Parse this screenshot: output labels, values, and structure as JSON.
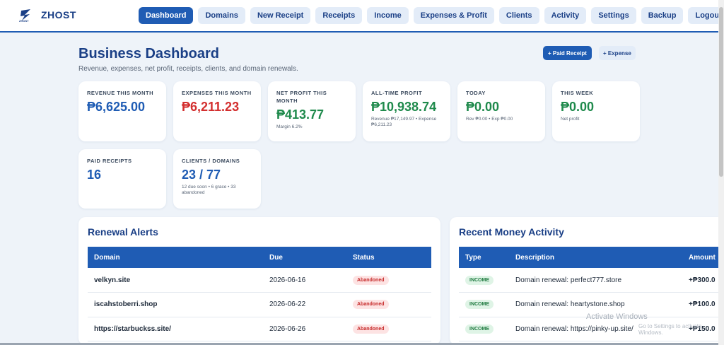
{
  "brand": {
    "name": "ZHOST"
  },
  "nav": [
    {
      "label": "Dashboard",
      "active": true
    },
    {
      "label": "Domains"
    },
    {
      "label": "New Receipt"
    },
    {
      "label": "Receipts"
    },
    {
      "label": "Income"
    },
    {
      "label": "Expenses & Profit"
    },
    {
      "label": "Clients"
    },
    {
      "label": "Activity"
    },
    {
      "label": "Settings"
    },
    {
      "label": "Backup"
    },
    {
      "label": "Logout"
    }
  ],
  "header": {
    "title": "Business Dashboard",
    "subtitle": "Revenue, expenses, net profit, receipts, clients, and domain renewals.",
    "paid_receipt_btn": "+ Paid Receipt",
    "expense_btn": "+ Expense"
  },
  "stats": {
    "revenue_month": {
      "label": "REVENUE THIS MONTH",
      "value": "₱6,625.00"
    },
    "expenses_month": {
      "label": "EXPENSES THIS MONTH",
      "value": "₱6,211.23"
    },
    "net_profit_month": {
      "label": "NET PROFIT THIS MONTH",
      "value": "₱413.77",
      "sub": "Margin 6.2%"
    },
    "all_time_profit": {
      "label": "ALL-TIME PROFIT",
      "value": "₱10,938.74",
      "sub": "Revenue ₱17,149.97 • Expense ₱6,211.23"
    },
    "today": {
      "label": "TODAY",
      "value": "₱0.00",
      "sub": "Rev ₱0.00 • Exp ₱0.00"
    },
    "this_week": {
      "label": "THIS WEEK",
      "value": "₱0.00",
      "sub": "Net profit"
    },
    "paid_receipts": {
      "label": "PAID RECEIPTS",
      "value": "16"
    },
    "clients_domains": {
      "label": "CLIENTS / DOMAINS",
      "value": "23 / 77",
      "sub": "12 due soon • 6 grace • 33 abandoned"
    }
  },
  "renewal_alerts": {
    "title": "Renewal Alerts",
    "columns": [
      "Domain",
      "Due",
      "Status"
    ],
    "rows": [
      {
        "domain": "velkyn.site",
        "due": "2026-06-16",
        "status": "Abandoned"
      },
      {
        "domain": "iscahstoberri.shop",
        "due": "2026-06-22",
        "status": "Abandoned"
      },
      {
        "domain": "https://starbuckss.site/",
        "due": "2026-06-26",
        "status": "Abandoned"
      }
    ]
  },
  "money_activity": {
    "title": "Recent Money Activity",
    "columns": [
      "Type",
      "Description",
      "Amount"
    ],
    "rows": [
      {
        "type": "INCOME",
        "description": "Domain renewal: perfect777.store",
        "amount": "+₱300.0"
      },
      {
        "type": "INCOME",
        "description": "Domain renewal: heartystone.shop",
        "amount": "+₱100.0"
      },
      {
        "type": "INCOME",
        "description": "Domain renewal: https://pinky-up.site/",
        "amount": "+₱150.0"
      }
    ]
  },
  "watermark": {
    "line1": "Activate Windows",
    "line2": "Go to Settings to activate Windows."
  },
  "colors": {
    "primary": "#1f5cb4",
    "revenue": "#1f5cb4",
    "expense": "#d32f2f",
    "profit": "#1f8a4c"
  }
}
